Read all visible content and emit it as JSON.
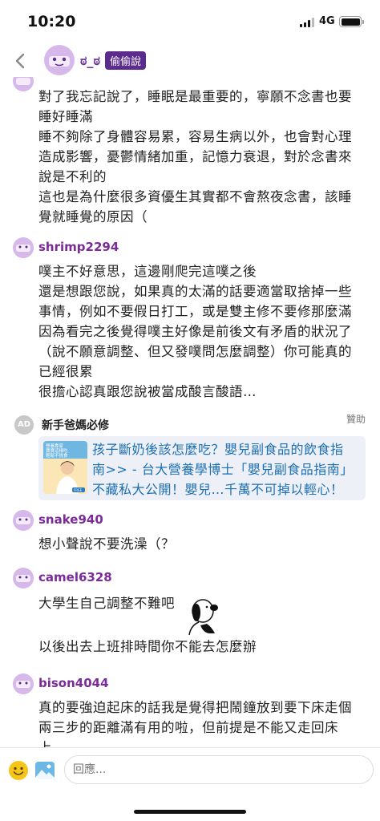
{
  "status_bar": {
    "time": "10:20",
    "network": "4G"
  },
  "header": {
    "user": "ಠ_ಠ",
    "board": "偷偷說"
  },
  "comments": [
    {
      "user": "",
      "lines": [
        "對了我忘記說了，睡眠是最重要的，寧願不念書也要",
        "睡好睡滿",
        "睡不夠除了身體容易累，容易生病以外，也會對心理",
        "造成影響，憂鬱情緒加重，記憶力衰退，對於念書來",
        "說是不利的",
        "這也是為什麼很多資優生其實都不會熬夜念書，該睡",
        "覺就睡覺的原因（"
      ]
    },
    {
      "user": "shrimp2294",
      "lines": [
        "噗主不好意思，這邊剛爬完這噗之後",
        "還是想跟您說，如果真的太滿的話要適當取捨掉一些",
        "事情，例如不要假日打工，或是雙主修不要修那麼滿",
        "因為看完之後覺得噗主好像是前後文有矛盾的狀況了",
        "（說不願意調整、但又發噗問怎麼調整）你可能真的",
        "已經很累",
        "很擔心認真跟您說被當成酸言酸語…"
      ]
    },
    {
      "user": "snake940",
      "lines": [
        "想小聲說不要洗澡（？"
      ]
    },
    {
      "user": "camel6328",
      "lines": [
        "大學生自己調整不難吧",
        "以後出去上班排時間你不能去怎麼辦"
      ]
    },
    {
      "user": "bison4044",
      "lines": [
        "真的要強迫起床的話我是覺得把鬧鐘放到要下床走個",
        "兩三步的距離滿有用的啦，但前提是不能又走回床",
        "上…"
      ]
    }
  ],
  "ad": {
    "badge": "AD",
    "sponsor": "新手爸媽必修",
    "sponsored_label": "贊助",
    "lines": [
      "孩子斷奶後該怎麼吃？嬰兒副食品的飲食指",
      "南>> - 台大營養學博士「嬰兒副食品指南」",
      "不藏私大公開！嬰兒…千萬不可掉以輕心！"
    ],
    "thumb_lines": [
      "營養專家",
      "寶寶這樣吃",
      "輕鬆不挑食"
    ],
    "thumb_caption": "FREE"
  },
  "reply": {
    "placeholder": "回應..."
  },
  "icons": {
    "back": "chevron-left-icon",
    "emoji": "smiley-icon",
    "image": "image-icon"
  },
  "colors": {
    "username": "#7b2a9a",
    "badge_bg": "#5b2c8e",
    "ad_link": "#1b6fb3",
    "ad_card_bg": "#eef0f8"
  }
}
